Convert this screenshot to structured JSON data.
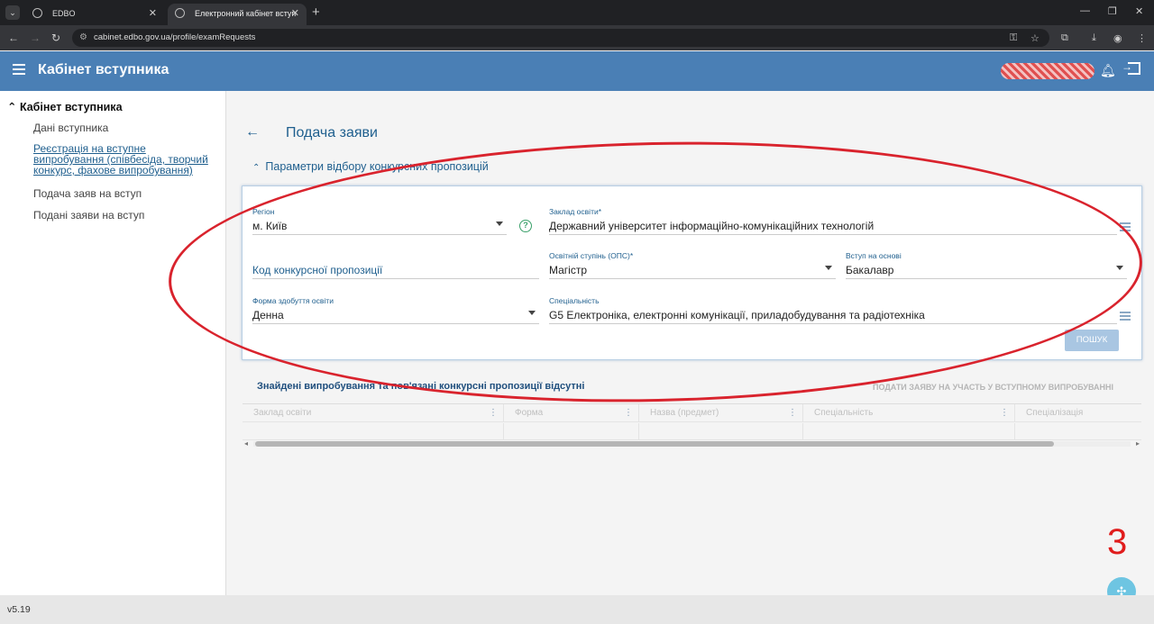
{
  "browser": {
    "tabs": [
      {
        "title": "EDBO"
      },
      {
        "title": "Електронний кабінет вступника"
      }
    ],
    "url": "cabinet.edbo.gov.ua/profile/examRequests"
  },
  "header": {
    "title": "Кабінет вступника"
  },
  "sidebar": {
    "heading": "Кабінет вступника",
    "items": [
      {
        "label": "Дані вступника"
      },
      {
        "label": "Реєстрація на вступне випробування (співбесіда, творчий конкурс, фахове випробування)"
      },
      {
        "label": "Подача заяв на вступ"
      },
      {
        "label": "Подані заяви на вступ"
      }
    ]
  },
  "page": {
    "title": "Подача заяви",
    "section_title": "Параметри відбору конкурсних пропозицій"
  },
  "form": {
    "region": {
      "label": "Регіон",
      "value": "м. Київ"
    },
    "institution": {
      "label": "Заклад освіти*",
      "value": "Державний університет інформаційно-комунікаційних технологій"
    },
    "offer_code": {
      "placeholder": "Код конкурсної пропозиції"
    },
    "degree": {
      "label": "Освітній ступінь (ОПС)*",
      "value": "Магістр"
    },
    "entry_basis": {
      "label": "Вступ на основі",
      "value": "Бакалавр"
    },
    "study_form": {
      "label": "Форма здобуття освіти",
      "value": "Денна"
    },
    "specialty": {
      "label": "Спеціальність",
      "value": "G5 Електроніка, електронні комунікації, приладобудування та радіотехніка"
    },
    "search_label": "ПОШУК"
  },
  "results": {
    "title": "Знайдені випробування та пов'язані конкурсні пропозиції відсутні",
    "apply_label": "ПОДАТИ ЗАЯВУ НА УЧАСТЬ У ВСТУПНОМУ ВИПРОБУВАННІ",
    "columns": [
      "Заклад освіти",
      "Форма",
      "Назва (предмет)",
      "Спеціальність",
      "Спеціалізація"
    ]
  },
  "annotation": {
    "number": "3",
    "color": "#d9232d"
  },
  "footer": {
    "version": "v5.19"
  },
  "colors": {
    "header_bg": "#4a7fb5",
    "link": "#1f5f8e",
    "button": "#a9c6e2"
  }
}
